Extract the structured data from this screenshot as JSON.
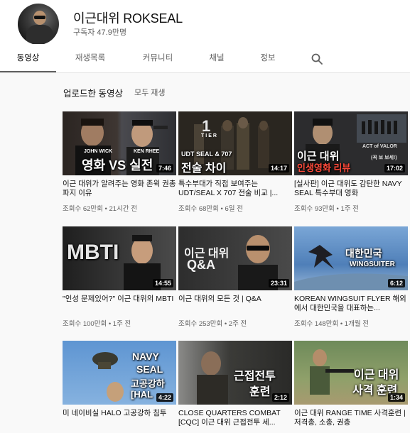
{
  "channel": {
    "name": "이근대위 ROKSEAL",
    "subscribers": "구독자 47.9만명"
  },
  "tabs": [
    {
      "label": "동영상"
    },
    {
      "label": "재생목록"
    },
    {
      "label": "커뮤니티"
    },
    {
      "label": "채널"
    },
    {
      "label": "정보"
    }
  ],
  "search_icon": "search-icon",
  "section": {
    "title": "업로드한 동영상",
    "play_all": "모두 재생"
  },
  "videos": [
    {
      "title": "이근 대위가 알려주는 영화 존윅 권총 파지 이유",
      "meta": "조회수 62만회 • 21시간 전",
      "duration": "7:46",
      "overlay": "영화 VS 실전",
      "overlay_small_left": "JOHN WICK",
      "overlay_small_right": "KEN RHEE"
    },
    {
      "title": "특수부대가 직접 보여주는 UDT/SEAL X 707 전술 비교 |...",
      "meta": "조회수 68만회 • 6일 전",
      "duration": "14:17",
      "overlay": "전술 차이",
      "overlay_small": "UDT SEAL & 707",
      "overlay_small_top": "TIER"
    },
    {
      "title": "[실사판] 이근 대위도 감탄한 NAVY SEAL 특수부대 영화",
      "meta": "조회수 93만회 • 1주 전",
      "duration": "17:02",
      "overlay": "이근 대위",
      "overlay_second": "인생영화 리뷰",
      "overlay_small": "ACT of VALOR"
    },
    {
      "title": "\"인성 문제있어?\" 이근 대위의 MBTI",
      "meta": "조회수 100만회 • 1주 전",
      "duration": "14:55",
      "overlay": "MBTI"
    },
    {
      "title": "이근 대위의 모든 것 | Q&A",
      "meta": "조회수 253만회 • 2주 전",
      "duration": "23:31",
      "overlay": "이근 대위",
      "overlay_second": "Q&A"
    },
    {
      "title": "KOREAN WINGSUIT FLYER 해외에서 대한민국을 대표하는...",
      "meta": "조회수 148만회 • 1개월 전",
      "duration": "6:12",
      "overlay": "대한민국",
      "overlay_second": "WINGSUITER"
    },
    {
      "title": "미 네이비실 HALO 고공강하 침투",
      "meta": "",
      "duration": "4:22",
      "overlay": "NAVY",
      "overlay_second": "SEAL",
      "overlay_third": "고공강하",
      "overlay_fourth": "[HAL"
    },
    {
      "title": "CLOSE QUARTERS COMBAT [CQC] 이근 대위 근접전투 세...",
      "meta": "",
      "duration": "2:12",
      "overlay": "근접전투",
      "overlay_second": "훈련"
    },
    {
      "title": "이근 대위 RANGE TIME 사격훈련 | 저격총, 소총, 권총",
      "meta": "",
      "duration": "1:34",
      "overlay": "이근 대위",
      "overlay_second": "사격 훈련"
    }
  ],
  "colors": {
    "background": "#f9f9f9",
    "text_primary": "#0f0f0f",
    "text_secondary": "#606060",
    "duration_badge": "#000000",
    "overlay_red": "#ff3b30"
  }
}
